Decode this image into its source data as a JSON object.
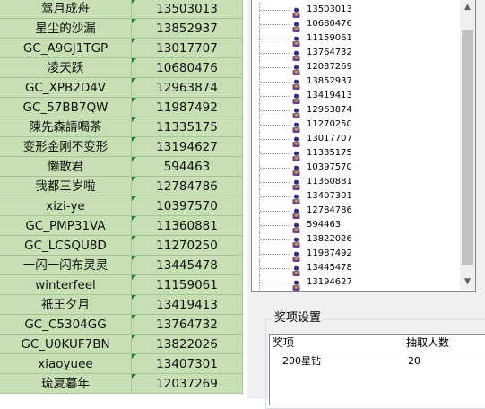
{
  "sheet": {
    "rows": [
      {
        "name": "驾月成舟",
        "id": "13503013"
      },
      {
        "name": "星尘的沙漏",
        "id": "13852937"
      },
      {
        "name": "GC_A9GJ1TGP",
        "id": "13017707"
      },
      {
        "name": "凌天跃",
        "id": "10680476"
      },
      {
        "name": "GC_XPB2D4V",
        "id": "12963874"
      },
      {
        "name": "GC_57BB7QW",
        "id": "11987492"
      },
      {
        "name": "陳先森請喝茶",
        "id": "11335175"
      },
      {
        "name": "变形金刚不变形",
        "id": "13194627"
      },
      {
        "name": "懒散君",
        "id": "594463"
      },
      {
        "name": "我都三岁啦",
        "id": "12784786"
      },
      {
        "name": "xizi-ye",
        "id": "10397570"
      },
      {
        "name": "GC_PMP31VA",
        "id": "11360881"
      },
      {
        "name": "GC_LCSQU8D",
        "id": "11270250"
      },
      {
        "name": "一闪一闪布灵灵",
        "id": "13445478"
      },
      {
        "name": "winterfeel",
        "id": "11159061"
      },
      {
        "name": "祇王夕月",
        "id": "13419413"
      },
      {
        "name": "GC_C5304GG",
        "id": "13764732"
      },
      {
        "name": "GC_U0KUF7BN",
        "id": "13822026"
      },
      {
        "name": "xiaoyuee",
        "id": "13407301"
      },
      {
        "name": "琉夏暮年",
        "id": "12037269"
      }
    ],
    "colors": {
      "cell_fill": "#c6e0b4",
      "comment_marker": "#1e7b34"
    }
  },
  "tree": {
    "items": [
      "13503013",
      "10680476",
      "11159061",
      "13764732",
      "12037269",
      "13852937",
      "13419413",
      "12963874",
      "11270250",
      "13017707",
      "11335175",
      "10397570",
      "11360881",
      "13407301",
      "12784786",
      "594463",
      "13822026",
      "11987492",
      "13445478",
      "13194627"
    ],
    "item_icon": "user-icon",
    "scroll_up_icon": "chevron-up-icon",
    "scroll_down_icon": "chevron-down-icon"
  },
  "prize": {
    "group_title": "奖项设置",
    "columns": [
      "奖项",
      "抽取人数"
    ],
    "rows": [
      {
        "prize": "200星钻",
        "count": "20"
      }
    ]
  }
}
